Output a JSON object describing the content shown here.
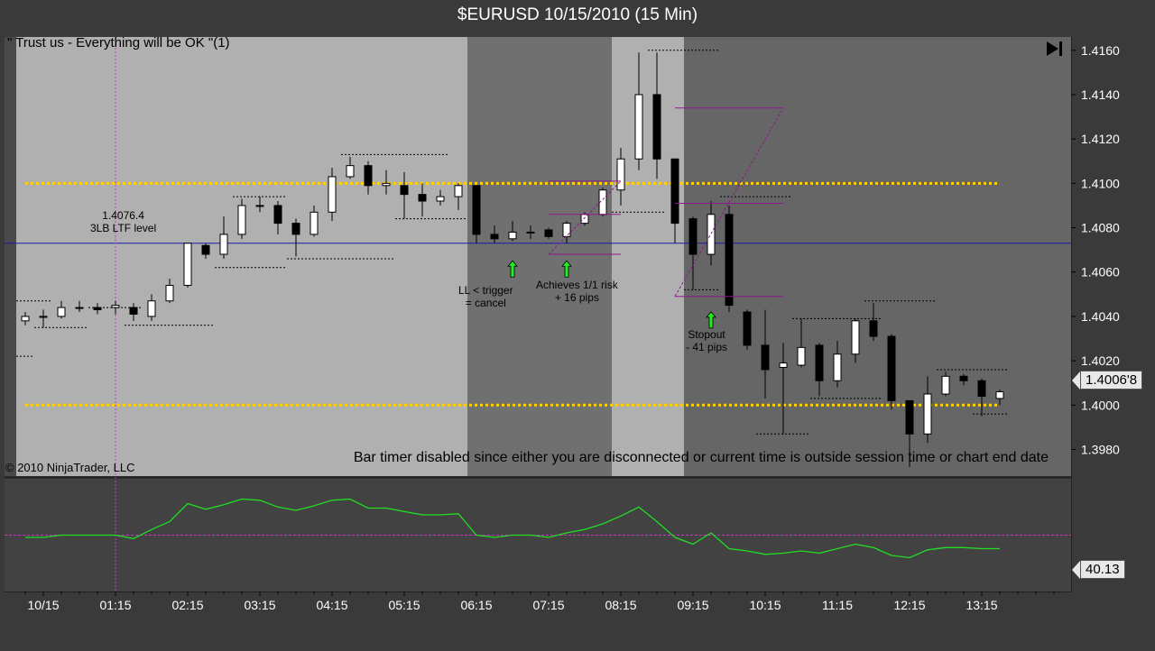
{
  "window": {
    "title": "$EURUSD  10/15/2010 (15 Min)",
    "strategy_label": "\" Trust us - Everything will be OK \"(1)",
    "copyright": "© 2010 NinjaTrader, LLC",
    "bar_timer": "Bar timer disabled since either you are disconnected or current time is outside session time or chart end date",
    "current_price_label": "1.4006'8",
    "indicator_value_label": "40.13"
  },
  "colors": {
    "candle_up": "#ffffff",
    "candle_down": "#000000",
    "level_line": "#ffd200",
    "ltf_line": "#1a1aa8",
    "indicator_line": "#22dd22",
    "indicator_mid": "#cc33cc",
    "session_light": "#b0b0b0",
    "session_dark": "#707070",
    "session_mid": "#666666"
  },
  "annotations": [
    {
      "id": "ltf",
      "text": "1.4076.4\n3LB LTF level"
    },
    {
      "id": "ll",
      "text": "LL < trigger\n= cancel"
    },
    {
      "id": "achieve",
      "text": "Achieves 1/1 risk\n+ 16 pips"
    },
    {
      "id": "stop",
      "text": "Stopout\n- 41 pips"
    }
  ],
  "chart_data": {
    "type": "candlestick",
    "title": "$EURUSD  10/15/2010 (15 Min)",
    "y_axis": {
      "ticks": [
        "1.4160",
        "1.4140",
        "1.4120",
        "1.4100",
        "1.4080",
        "1.4060",
        "1.4040",
        "1.4020",
        "1.4000",
        "1.3980"
      ],
      "ylim": [
        1.3968,
        1.4166
      ]
    },
    "x_axis": {
      "ticks": [
        "10/15",
        "01:15",
        "02:15",
        "03:15",
        "04:15",
        "05:15",
        "06:15",
        "07:15",
        "08:15",
        "09:15",
        "10:15",
        "11:15",
        "12:15",
        "13:15"
      ]
    },
    "levels": [
      1.41,
      1.4
    ],
    "ltf_level": 1.4073,
    "candles": [
      {
        "o": 1.4038,
        "h": 1.4042,
        "l": 1.4036,
        "c": 1.404
      },
      {
        "o": 1.404,
        "h": 1.4043,
        "l": 1.4035,
        "c": 1.404
      },
      {
        "o": 1.404,
        "h": 1.4047,
        "l": 1.4039,
        "c": 1.4044
      },
      {
        "o": 1.4044,
        "h": 1.4047,
        "l": 1.4042,
        "c": 1.4044
      },
      {
        "o": 1.4044,
        "h": 1.4046,
        "l": 1.4041,
        "c": 1.4043
      },
      {
        "o": 1.4044,
        "h": 1.4047,
        "l": 1.4041,
        "c": 1.4045
      },
      {
        "o": 1.4044,
        "h": 1.4046,
        "l": 1.4038,
        "c": 1.4041
      },
      {
        "o": 1.404,
        "h": 1.405,
        "l": 1.4038,
        "c": 1.4047
      },
      {
        "o": 1.4047,
        "h": 1.4057,
        "l": 1.4046,
        "c": 1.4054
      },
      {
        "o": 1.4054,
        "h": 1.4073,
        "l": 1.4053,
        "c": 1.4073
      },
      {
        "o": 1.4072,
        "h": 1.4073,
        "l": 1.4066,
        "c": 1.4068
      },
      {
        "o": 1.4068,
        "h": 1.4085,
        "l": 1.4066,
        "c": 1.4077
      },
      {
        "o": 1.4077,
        "h": 1.4093,
        "l": 1.4075,
        "c": 1.409
      },
      {
        "o": 1.409,
        "h": 1.4094,
        "l": 1.4087,
        "c": 1.409
      },
      {
        "o": 1.409,
        "h": 1.4092,
        "l": 1.4077,
        "c": 1.4082
      },
      {
        "o": 1.4082,
        "h": 1.4084,
        "l": 1.4067,
        "c": 1.4077
      },
      {
        "o": 1.4077,
        "h": 1.409,
        "l": 1.4076,
        "c": 1.4087
      },
      {
        "o": 1.4087,
        "h": 1.4107,
        "l": 1.4083,
        "c": 1.4103
      },
      {
        "o": 1.4103,
        "h": 1.4112,
        "l": 1.4102,
        "c": 1.4108
      },
      {
        "o": 1.4108,
        "h": 1.411,
        "l": 1.4095,
        "c": 1.4099
      },
      {
        "o": 1.4099,
        "h": 1.4106,
        "l": 1.4095,
        "c": 1.41
      },
      {
        "o": 1.4099,
        "h": 1.4105,
        "l": 1.4084,
        "c": 1.4095
      },
      {
        "o": 1.4095,
        "h": 1.41,
        "l": 1.4085,
        "c": 1.4092
      },
      {
        "o": 1.4092,
        "h": 1.4097,
        "l": 1.409,
        "c": 1.4094
      },
      {
        "o": 1.4094,
        "h": 1.41,
        "l": 1.4088,
        "c": 1.4099
      },
      {
        "o": 1.4099,
        "h": 1.4098,
        "l": 1.4073,
        "c": 1.4077
      },
      {
        "o": 1.4077,
        "h": 1.4081,
        "l": 1.4073,
        "c": 1.4075
      },
      {
        "o": 1.4075,
        "h": 1.4083,
        "l": 1.4074,
        "c": 1.4078
      },
      {
        "o": 1.4078,
        "h": 1.4081,
        "l": 1.4075,
        "c": 1.4078
      },
      {
        "o": 1.4079,
        "h": 1.408,
        "l": 1.4075,
        "c": 1.4076
      },
      {
        "o": 1.4076,
        "h": 1.4083,
        "l": 1.4073,
        "c": 1.4082
      },
      {
        "o": 1.4082,
        "h": 1.4087,
        "l": 1.4081,
        "c": 1.4086
      },
      {
        "o": 1.4086,
        "h": 1.4098,
        "l": 1.4085,
        "c": 1.4097
      },
      {
        "o": 1.4097,
        "h": 1.4116,
        "l": 1.409,
        "c": 1.4111
      },
      {
        "o": 1.4111,
        "h": 1.4159,
        "l": 1.4106,
        "c": 1.414
      },
      {
        "o": 1.414,
        "h": 1.4159,
        "l": 1.4102,
        "c": 1.4111
      },
      {
        "o": 1.4111,
        "h": 1.4104,
        "l": 1.4073,
        "c": 1.4082
      },
      {
        "o": 1.4084,
        "h": 1.4085,
        "l": 1.4052,
        "c": 1.4068
      },
      {
        "o": 1.4068,
        "h": 1.4092,
        "l": 1.4063,
        "c": 1.4086
      },
      {
        "o": 1.4086,
        "h": 1.409,
        "l": 1.4042,
        "c": 1.4045
      },
      {
        "o": 1.4042,
        "h": 1.4043,
        "l": 1.4025,
        "c": 1.4027
      },
      {
        "o": 1.4027,
        "h": 1.4043,
        "l": 1.4003,
        "c": 1.4016
      },
      {
        "o": 1.4017,
        "h": 1.4028,
        "l": 1.3987,
        "c": 1.4019
      },
      {
        "o": 1.4018,
        "h": 1.4039,
        "l": 1.4017,
        "c": 1.4026
      },
      {
        "o": 1.4027,
        "h": 1.4028,
        "l": 1.4004,
        "c": 1.4011
      },
      {
        "o": 1.4011,
        "h": 1.4029,
        "l": 1.4008,
        "c": 1.4023
      },
      {
        "o": 1.4023,
        "h": 1.4039,
        "l": 1.4019,
        "c": 1.4038
      },
      {
        "o": 1.4038,
        "h": 1.4046,
        "l": 1.4029,
        "c": 1.4031
      },
      {
        "o": 1.4031,
        "h": 1.4032,
        "l": 1.3998,
        "c": 1.4002
      },
      {
        "o": 1.4002,
        "h": 1.4002,
        "l": 1.3972,
        "c": 1.3987
      },
      {
        "o": 1.3987,
        "h": 1.4013,
        "l": 1.3983,
        "c": 1.4005
      },
      {
        "o": 1.4005,
        "h": 1.4015,
        "l": 1.4004,
        "c": 1.4013
      },
      {
        "o": 1.4013,
        "h": 1.4014,
        "l": 1.4009,
        "c": 1.4011
      },
      {
        "o": 1.4011,
        "h": 1.4012,
        "l": 1.3995,
        "c": 1.4004
      },
      {
        "o": 1.4003,
        "h": 1.4007,
        "l": 1.4,
        "c": 1.4006
      }
    ],
    "indicator": {
      "ylim": [
        0,
        100
      ],
      "mid_level": 50,
      "values": [
        48,
        48,
        50,
        50,
        50,
        50,
        47,
        55,
        62,
        78,
        73,
        77,
        82,
        81,
        75,
        72,
        76,
        81,
        82,
        74,
        74,
        71,
        68,
        68,
        69,
        50,
        48,
        50,
        50,
        48,
        52,
        55,
        60,
        67,
        75,
        62,
        48,
        42,
        52,
        38,
        36,
        33,
        34,
        36,
        34,
        38,
        42,
        39,
        32,
        30,
        37,
        39,
        39,
        38,
        38
      ]
    }
  }
}
